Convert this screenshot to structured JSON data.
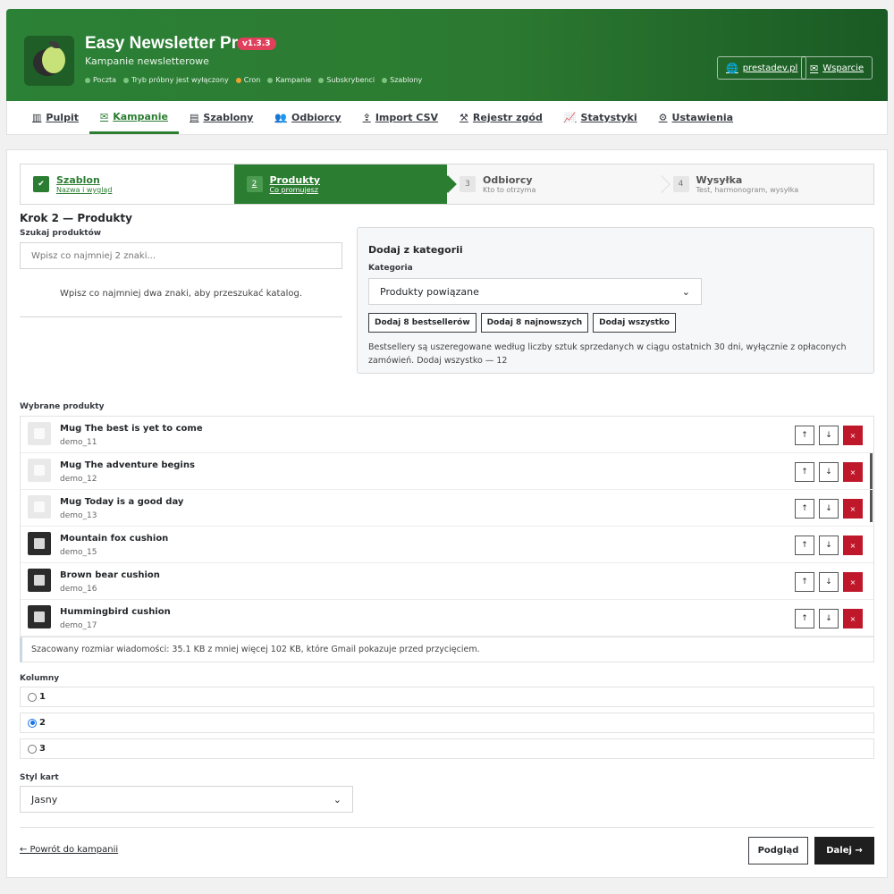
{
  "header": {
    "title": "Easy Newsletter Pro",
    "version": "v1.3.3",
    "subtitle": "Kampanie newsletterowe",
    "status": [
      {
        "label": "Poczta",
        "state": "ok"
      },
      {
        "label": "Tryb próbny jest wyłączony",
        "state": "ok"
      },
      {
        "label": "Cron",
        "state": "warn"
      },
      {
        "label": "Kampanie",
        "state": "ok"
      },
      {
        "label": "Subskrybenci",
        "state": "ok"
      },
      {
        "label": "Szablony",
        "state": "ok"
      }
    ],
    "link_prestadev": "prestadev.pl",
    "link_support": "Wsparcie"
  },
  "nav": [
    {
      "label": "Pulpit",
      "icon": "chart-bar-icon"
    },
    {
      "label": "Kampanie",
      "icon": "envelope-icon",
      "active": true
    },
    {
      "label": "Szablony",
      "icon": "file-icon"
    },
    {
      "label": "Odbiorcy",
      "icon": "users-icon"
    },
    {
      "label": "Import CSV",
      "icon": "upload-icon"
    },
    {
      "label": "Rejestr zgód",
      "icon": "gavel-icon"
    },
    {
      "label": "Statystyki",
      "icon": "line-chart-icon"
    },
    {
      "label": "Ustawienia",
      "icon": "cogs-icon"
    }
  ],
  "steps": [
    {
      "num": "✔",
      "title": "Szablon",
      "sub": "Nazwa i wygląd",
      "state": "done"
    },
    {
      "num": "2",
      "title": "Produkty",
      "sub": "Co promujesz",
      "state": "active"
    },
    {
      "num": "3",
      "title": "Odbiorcy",
      "sub": "Kto to otrzyma",
      "state": "todo"
    },
    {
      "num": "4",
      "title": "Wysyłka",
      "sub": "Test, harmonogram, wysyłka",
      "state": "todo"
    }
  ],
  "step_heading": "Krok 2 — Produkty",
  "search": {
    "label": "Szukaj produktów",
    "placeholder": "Wpisz co najmniej 2 znaki...",
    "hint": "Wpisz co najmniej dwa znaki, aby przeszukać katalog."
  },
  "category_box": {
    "title": "Dodaj z kategorii",
    "label": "Kategoria",
    "selected": "Produkty powiązane",
    "btn_bestsellers": "Dodaj 8 bestsellerów",
    "btn_newest": "Dodaj 8 najnowszych",
    "btn_all": "Dodaj wszystko",
    "note": "Bestsellery są uszeregowane według liczby sztuk sprzedanych w ciągu ostatnich 30 dni, wyłącznie z opłaconych zamówień. Dodaj wszystko — 12"
  },
  "selected_label": "Wybrane produkty",
  "products": [
    {
      "name": "Mug The best is yet to come",
      "ref": "demo_11",
      "kind": "mug"
    },
    {
      "name": "Mug The adventure begins",
      "ref": "demo_12",
      "kind": "mug"
    },
    {
      "name": "Mug Today is a good day",
      "ref": "demo_13",
      "kind": "mug"
    },
    {
      "name": "Mountain fox cushion",
      "ref": "demo_15",
      "kind": "cushion"
    },
    {
      "name": "Brown bear cushion",
      "ref": "demo_16",
      "kind": "cushion"
    },
    {
      "name": "Hummingbird cushion",
      "ref": "demo_17",
      "kind": "cushion"
    }
  ],
  "product_actions": {
    "up": "↑",
    "down": "↓",
    "remove": "×"
  },
  "size_note": "Szacowany rozmiar wiadomości: 35.1 KB z mniej więcej 102 KB, które Gmail pokazuje przed przycięciem.",
  "columns": {
    "label": "Kolumny",
    "options": [
      "1",
      "2",
      "3"
    ],
    "selected": "2"
  },
  "card_style": {
    "label": "Styl kart",
    "selected": "Jasny"
  },
  "footer": {
    "back": "← Powrót do kampanii",
    "preview": "Podgląd",
    "next": "Dalej →"
  },
  "colors": {
    "brand": "#2b7d32",
    "danger": "#c0182b",
    "dark": "#1f1f1f"
  }
}
